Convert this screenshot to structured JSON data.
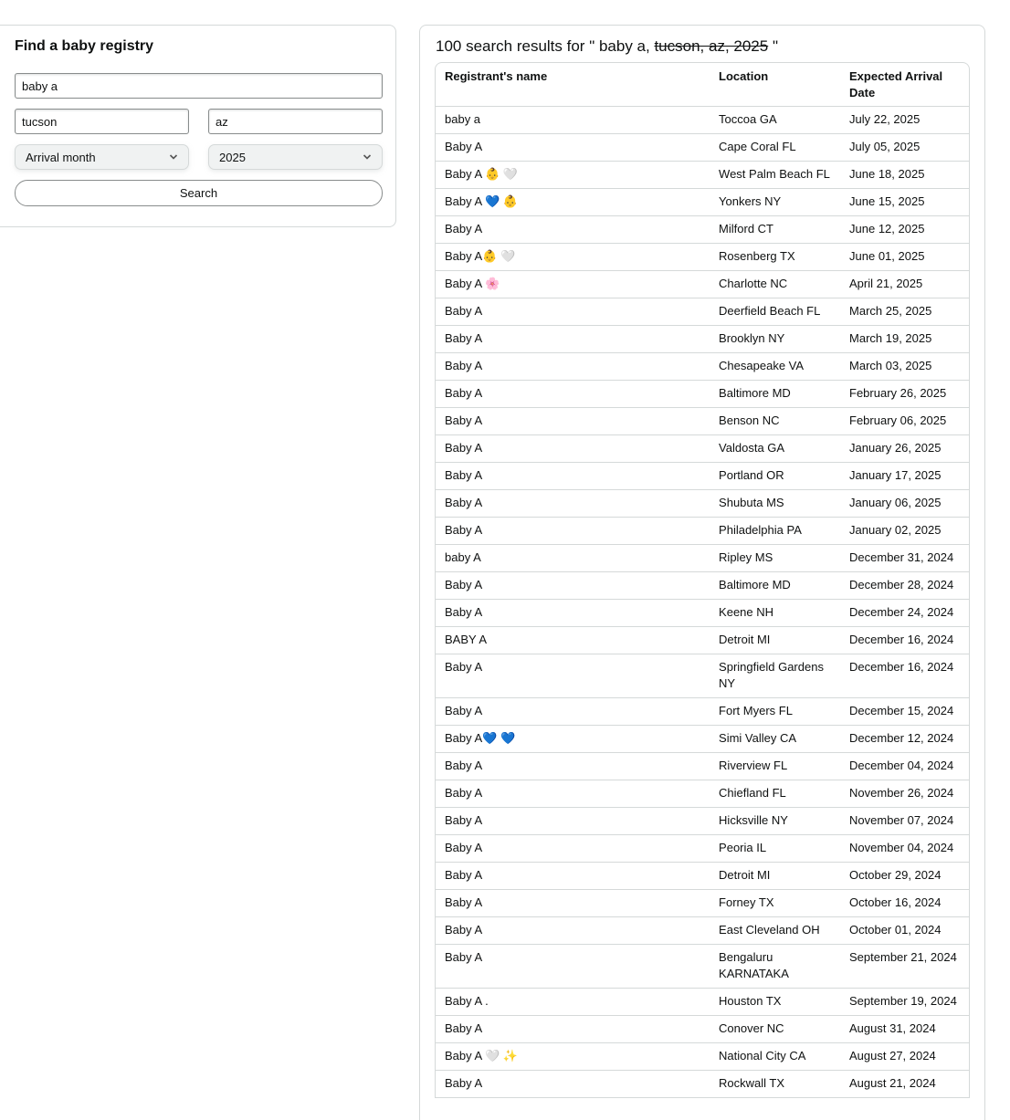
{
  "search_form": {
    "title": "Find a baby registry",
    "name_value": "baby a",
    "city_value": "tucson",
    "state_value": "az",
    "month_select": "Arrival month",
    "year_select": "2025",
    "search_label": "Search"
  },
  "results": {
    "count_prefix": "100 search results for \" ",
    "query_active": "baby a, ",
    "query_struck": "tucson, az, 2025",
    "count_suffix": " \"",
    "columns": {
      "name": "Registrant's name",
      "location": "Location",
      "date": "Expected Arrival Date"
    },
    "rows": [
      {
        "name": "baby a",
        "location": "Toccoa GA",
        "date": "July 22, 2025"
      },
      {
        "name": "Baby A",
        "location": "Cape Coral FL",
        "date": "July 05, 2025"
      },
      {
        "name": "Baby A 👶 🤍",
        "location": "West Palm Beach FL",
        "date": "June 18, 2025"
      },
      {
        "name": "Baby A 💙 👶",
        "location": "Yonkers NY",
        "date": "June 15, 2025"
      },
      {
        "name": "Baby A",
        "location": "Milford CT",
        "date": "June 12, 2025"
      },
      {
        "name": "Baby A👶 🤍",
        "location": "Rosenberg TX",
        "date": "June 01, 2025"
      },
      {
        "name": "Baby A 🌸",
        "location": "Charlotte NC",
        "date": "April 21, 2025"
      },
      {
        "name": "Baby A",
        "location": "Deerfield Beach FL",
        "date": "March 25, 2025"
      },
      {
        "name": "Baby A",
        "location": "Brooklyn NY",
        "date": "March 19, 2025"
      },
      {
        "name": "Baby A",
        "location": "Chesapeake VA",
        "date": "March 03, 2025"
      },
      {
        "name": "Baby A",
        "location": "Baltimore MD",
        "date": "February 26, 2025"
      },
      {
        "name": "Baby A",
        "location": "Benson NC",
        "date": "February 06, 2025"
      },
      {
        "name": "Baby A",
        "location": "Valdosta GA",
        "date": "January 26, 2025"
      },
      {
        "name": "Baby A",
        "location": "Portland OR",
        "date": "January 17, 2025"
      },
      {
        "name": "Baby A",
        "location": "Shubuta MS",
        "date": "January 06, 2025"
      },
      {
        "name": "Baby A",
        "location": "Philadelphia PA",
        "date": "January 02, 2025"
      },
      {
        "name": "baby A",
        "location": "Ripley MS",
        "date": "December 31, 2024"
      },
      {
        "name": "Baby A",
        "location": "Baltimore MD",
        "date": "December 28, 2024"
      },
      {
        "name": "Baby A",
        "location": "Keene NH",
        "date": "December 24, 2024"
      },
      {
        "name": "BABY A",
        "location": "Detroit MI",
        "date": "December 16, 2024"
      },
      {
        "name": "Baby A",
        "location": "Springfield Gardens NY",
        "date": "December 16, 2024"
      },
      {
        "name": "Baby A",
        "location": "Fort Myers FL",
        "date": "December 15, 2024"
      },
      {
        "name": "Baby A💙 💙",
        "location": "Simi Valley CA",
        "date": "December 12, 2024"
      },
      {
        "name": "Baby A",
        "location": "Riverview FL",
        "date": "December 04, 2024"
      },
      {
        "name": "Baby A",
        "location": "Chiefland FL",
        "date": "November 26, 2024"
      },
      {
        "name": "Baby A",
        "location": "Hicksville NY",
        "date": "November 07, 2024"
      },
      {
        "name": "Baby A",
        "location": "Peoria IL",
        "date": "November 04, 2024"
      },
      {
        "name": "Baby A",
        "location": "Detroit MI",
        "date": "October 29, 2024"
      },
      {
        "name": "Baby A",
        "location": "Forney TX",
        "date": "October 16, 2024"
      },
      {
        "name": "Baby A",
        "location": "East Cleveland OH",
        "date": "October 01, 2024"
      },
      {
        "name": "Baby A",
        "location": "Bengaluru KARNATAKA",
        "date": "September 21, 2024"
      },
      {
        "name": "Baby A .",
        "location": "Houston TX",
        "date": "September 19, 2024"
      },
      {
        "name": "Baby A",
        "location": "Conover NC",
        "date": "August 31, 2024"
      },
      {
        "name": "Baby A 🤍 ✨",
        "location": "National City CA",
        "date": "August 27, 2024"
      },
      {
        "name": "Baby A",
        "location": "Rockwall TX",
        "date": "August 21, 2024"
      }
    ]
  }
}
